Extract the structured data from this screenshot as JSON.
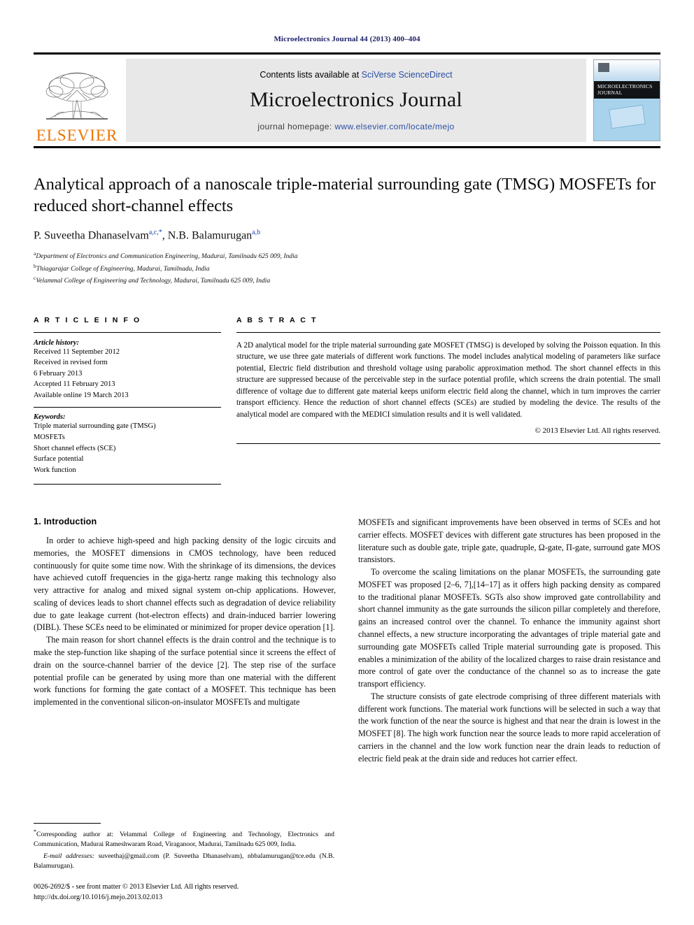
{
  "running_head": "Microelectronics Journal 44 (2013) 400–404",
  "masthead": {
    "elsevier_wordmark": "ELSEVIER",
    "contents_prefix": "Contents lists available at ",
    "contents_link": "SciVerse ScienceDirect",
    "journal_name": "Microelectronics Journal",
    "homepage_prefix": "journal homepage: ",
    "homepage_url": "www.elsevier.com/locate/mejo",
    "cover_title_line1": "MICROELECTRONICS",
    "cover_title_line2": "JOURNAL"
  },
  "article": {
    "title": "Analytical approach of a nanoscale triple-material surrounding gate (TMSG) MOSFETs for reduced short-channel effects",
    "authors": [
      {
        "name": "P. Suveetha Dhanaselvam",
        "marks": "a,c,*"
      },
      {
        "name": "N.B. Balamurugan",
        "marks": "a,b"
      }
    ],
    "affiliations": [
      {
        "mark": "a",
        "text": "Department of Electronics and Communication Engineering, Madurai, Tamilnadu 625 009, India"
      },
      {
        "mark": "b",
        "text": "Thiagarajar College of Engineering, Madurai, Tamilnadu, India"
      },
      {
        "mark": "c",
        "text": "Velammal College of Engineering and Technology, Madurai, Tamilnadu 625 009, India"
      }
    ]
  },
  "article_info": {
    "heading": "A R T I C L E   I N F O",
    "history_label": "Article history:",
    "history_lines": [
      "Received 11 September 2012",
      "Received in revised form",
      "6 February 2013",
      "Accepted 11 February 2013",
      "Available online 19 March 2013"
    ],
    "keywords_label": "Keywords:",
    "keywords": [
      "Triple material surrounding gate (TMSG)",
      "MOSFETs",
      "Short channel effects (SCE)",
      "Surface potential",
      "Work function"
    ]
  },
  "abstract": {
    "heading": "A B S T R A C T",
    "text": "A 2D analytical model for the triple material surrounding gate MOSFET (TMSG) is developed by solving the Poisson equation. In this structure, we use three gate materials of different work functions. The model includes analytical modeling of parameters like surface potential, Electric field distribution and threshold voltage using parabolic approximation method. The short channel effects in this structure are suppressed because of the perceivable step in the surface potential profile, which screens the drain potential. The small difference of voltage due to different gate material keeps uniform electric field along the channel, which in turn improves the carrier transport efficiency. Hence the reduction of short channel effects (SCEs) are studied by modeling the device. The results of the analytical model are compared with the MEDICI simulation results and it is well validated.",
    "copyright": "© 2013 Elsevier Ltd. All rights reserved."
  },
  "body": {
    "section_title": "1.  Introduction",
    "left_paragraphs": [
      "In order to achieve high-speed and high packing density of the logic circuits and memories, the MOSFET dimensions in CMOS technology, have been reduced continuously for quite some time now. With the shrinkage of its dimensions, the devices have achieved cutoff frequencies in the giga-hertz range making this technology also very attractive for analog and mixed signal system on-chip applications. However, scaling of devices leads to short channel effects such as degradation of device reliability due to gate leakage current (hot-electron effects) and drain-induced barrier lowering (DIBL). These SCEs need to be eliminated or minimized for proper device operation [1].",
      "The main reason for short channel effects is the drain control and the technique is to make the step-function like shaping of the surface potential since it screens the effect of drain on the source-channel barrier of the device [2]. The step rise of the surface potential profile can be generated by using more than one material with the different work functions for forming the gate contact of a MOSFET. This technique has been implemented in the conventional silicon-on-insulator MOSFETs and multigate"
    ],
    "right_paragraphs": [
      "MOSFETs and significant improvements have been observed in terms of SCEs and hot carrier effects. MOSFET devices with different gate structures has been proposed in the literature such as double gate, triple gate, quadruple, Ω-gate, Π-gate, surround gate MOS transistors.",
      "To overcome the scaling limitations on the planar MOSFETs, the surrounding gate MOSFET was proposed [2–6, 7],[14–17] as it offers high packing density as compared to the traditional planar MOSFETs. SGTs also show improved gate controllability and short channel immunity as the gate surrounds the silicon pillar completely and therefore, gains an increased control over the channel. To enhance the immunity against short channel effects, a new structure incorporating the advantages of triple material gate and surrounding gate MOSFETs called Triple material surrounding gate is proposed. This enables a minimization of the ability of the localized charges to raise drain resistance and more control of gate over the conductance of the channel so as to increase the gate transport efficiency.",
      "The structure consists of gate electrode comprising of three different materials with different work functions. The material work functions will be selected in such a way that the work function of the near the source is highest and that near the drain is lowest in the MOSFET [8]. The high work function near the source leads to more rapid acceleration of carriers in the channel and the low work function near the drain leads to reduction of electric field peak at the drain side and reduces hot carrier effect."
    ]
  },
  "footnote": {
    "corresponding": "Corresponding author at: Velammal College of Engineering and Technology, Electronics and Communication, Madurai Rameshwaram Road, Viraganoor, Madurai, Tamilnadu 625 009, India.",
    "email_label": "E-mail addresses:",
    "email_text": " suveethaj@gmail.com (P. Suveetha Dhanaselvam), nbbalamurugan@tce.edu (N.B. Balamurugan)."
  },
  "footer": {
    "issn_line": "0026-2692/$ - see front matter © 2013 Elsevier Ltd. All rights reserved.",
    "doi_line": "http://dx.doi.org/10.1016/j.mejo.2013.02.013"
  },
  "colors": {
    "running_head": "#1b1f66",
    "link": "#2b4ea2",
    "citation": "#1b3faa",
    "elsevier_orange": "#ec7404",
    "band_gray": "#e8e8e8"
  }
}
